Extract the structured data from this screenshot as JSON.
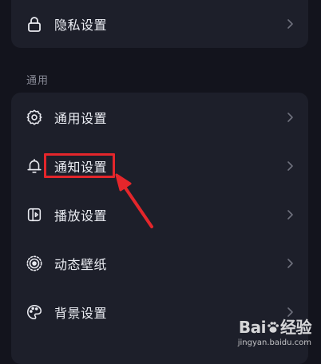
{
  "privacy": {
    "label": "隐私设置",
    "icon": "lock-icon"
  },
  "section": {
    "title": "通用"
  },
  "items": [
    {
      "label": "通用设置",
      "icon": "gear-icon"
    },
    {
      "label": "通知设置",
      "icon": "bell-icon"
    },
    {
      "label": "播放设置",
      "icon": "play-settings-icon"
    },
    {
      "label": "动态壁纸",
      "icon": "live-wallpaper-icon"
    },
    {
      "label": "背景设置",
      "icon": "palette-icon"
    }
  ],
  "annotation": {
    "highlight_color": "#e4262b"
  },
  "watermark": {
    "brand_left": "Bai",
    "brand_right": "经验",
    "url": "jingyan.baidu.com"
  },
  "colors": {
    "background": "#13141d",
    "card": "#1d1f2a",
    "text": "#eceef4",
    "secondary_text": "#8a8c98"
  }
}
